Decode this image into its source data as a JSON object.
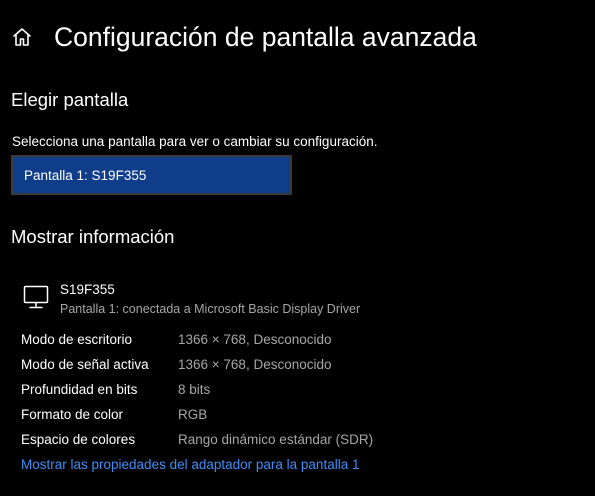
{
  "header": {
    "title": "Configuración de pantalla avanzada",
    "home_icon": "home-icon"
  },
  "choose_display": {
    "heading": "Elegir pantalla",
    "description": "Selecciona una pantalla para ver o cambiar su configuración.",
    "selected": "Pantalla 1: S19F355"
  },
  "display_info": {
    "heading": "Mostrar información",
    "monitor_icon": "monitor-icon",
    "name": "S19F355",
    "subtitle": "Pantalla 1: conectada a Microsoft Basic Display Driver",
    "rows": [
      {
        "label": "Modo de escritorio",
        "value": "1366 × 768, Desconocido"
      },
      {
        "label": "Modo de señal activa",
        "value": "1366 × 768, Desconocido"
      },
      {
        "label": "Profundidad en bits",
        "value": "8 bits"
      },
      {
        "label": "Formato de color",
        "value": "RGB"
      },
      {
        "label": "Espacio de colores",
        "value": "Rango dinámico estándar (SDR)"
      }
    ],
    "adapter_link": "Mostrar las propiedades del adaptador para la pantalla 1"
  },
  "colors": {
    "background": "#000000",
    "select_fill": "#0f3d8a",
    "link": "#3c8ef5",
    "secondary_text": "#a6a6a6"
  }
}
